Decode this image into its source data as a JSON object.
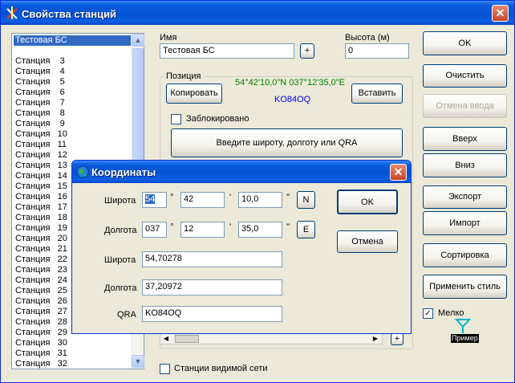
{
  "window": {
    "title": "Свойства станций",
    "close_symbol": "✕"
  },
  "stations_list": {
    "items": [
      "Тестовая БС",
      "",
      "Станция    3",
      "Станция    4",
      "Станция    5",
      "Станция    6",
      "Станция    7",
      "Станция    8",
      "Станция    9",
      "Станция   10",
      "Станция   11",
      "Станция   12",
      "Станция   13",
      "Станция   14",
      "Станция   15",
      "Станция   16",
      "Станция   17",
      "Станция   18",
      "Станция   19",
      "Станция   20",
      "Станция   21",
      "Станция   22",
      "Станция   23",
      "Станция   24",
      "Станция   25",
      "Станция   26",
      "Станция   27",
      "Станция   28",
      "Станция   29",
      "Станция   30",
      "Станция   31",
      "Станция   32"
    ],
    "selected_index": 0
  },
  "name": {
    "label": "Имя",
    "value": "Тестовая БС",
    "plus": "+"
  },
  "height": {
    "label": "Высота (м)",
    "value": "0"
  },
  "position": {
    "label": "Позиция",
    "coords": "54°42'10,0\"N 037°12'35,0\"E",
    "coords_color": "#008000",
    "qra": "KO84OQ",
    "qra_color": "#0000ff",
    "copy_button": "Копировать",
    "paste_button": "Вставить",
    "locked_label": "Заблокировано",
    "locked": false,
    "enter_button": "Введите широту, долготу или QRA"
  },
  "right_buttons": {
    "ok": "OK",
    "clear": "Очистить",
    "undo": "Отмена ввода",
    "up": "Вверх",
    "down": "Вниз",
    "export": "Экспорт",
    "import": "Импорт",
    "sort": "Сортировка",
    "apply_style": "Применить стиль"
  },
  "fine": {
    "label": "Мелко",
    "checked": true,
    "check_mark": "✓",
    "preview_label": "Пример"
  },
  "visible_net": {
    "label": "Станции видимой сети",
    "checked": false
  },
  "bottom_plus": "+",
  "dialog": {
    "title": "Координаты",
    "close_symbol": "✕",
    "lat_label": "Широта",
    "lat_deg": "54",
    "lat_min": "42",
    "lat_sec": "10,0",
    "lat_hemi": "N",
    "lon_label": "Долгота",
    "lon_deg": "037",
    "lon_min": "12",
    "lon_sec": "35,0",
    "lon_hemi": "E",
    "deg_sym": "°",
    "min_sym": "'",
    "sec_sym": "''",
    "lat_dec_label": "Широта",
    "lat_dec": "54,70278",
    "lon_dec_label": "Долгота",
    "lon_dec": "37,20972",
    "qra_label": "QRA",
    "qra": "KO84OQ",
    "ok": "OK",
    "cancel": "Отмена"
  }
}
